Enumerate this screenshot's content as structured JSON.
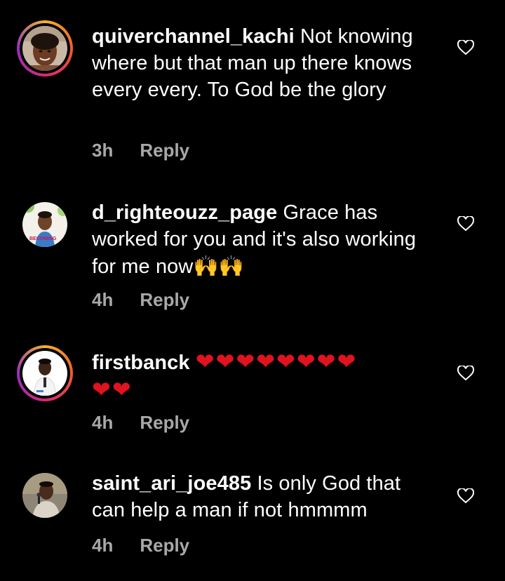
{
  "comments": [
    {
      "username": "quiverchannel_kachi",
      "text": "Not knowing where but that man up there knows every every. To God be the glory",
      "time": "3h",
      "reply": "Reply",
      "avatar_icon": "woman-selfie-avatar",
      "has_story_ring": true
    },
    {
      "username": "d_righteouzz_page",
      "text": "Grace has worked for you and it's also working for me now",
      "emoji": "🙌🙌",
      "time": "4h",
      "reply": "Reply",
      "avatar_icon": "man-portrait-avatar",
      "avatar_caption": "BECOMING",
      "has_story_ring": false
    },
    {
      "username": "firstbanck",
      "hearts_line1": "❤❤❤❤❤❤❤❤",
      "hearts_line2": "❤❤",
      "time": "4h",
      "reply": "Reply",
      "avatar_icon": "man-white-shirt-avatar",
      "has_story_ring": true
    },
    {
      "username": "saint_ari_joe485",
      "text": "Is only God that can help a man if not hmmmm",
      "time": "4h",
      "reply": "Reply",
      "avatar_icon": "man-microphone-avatar",
      "has_story_ring": false
    }
  ],
  "colors": {
    "background": "#000000",
    "text": "#ffffff",
    "meta": "#a8a8a8",
    "heart_emoji": "#e0131f"
  }
}
